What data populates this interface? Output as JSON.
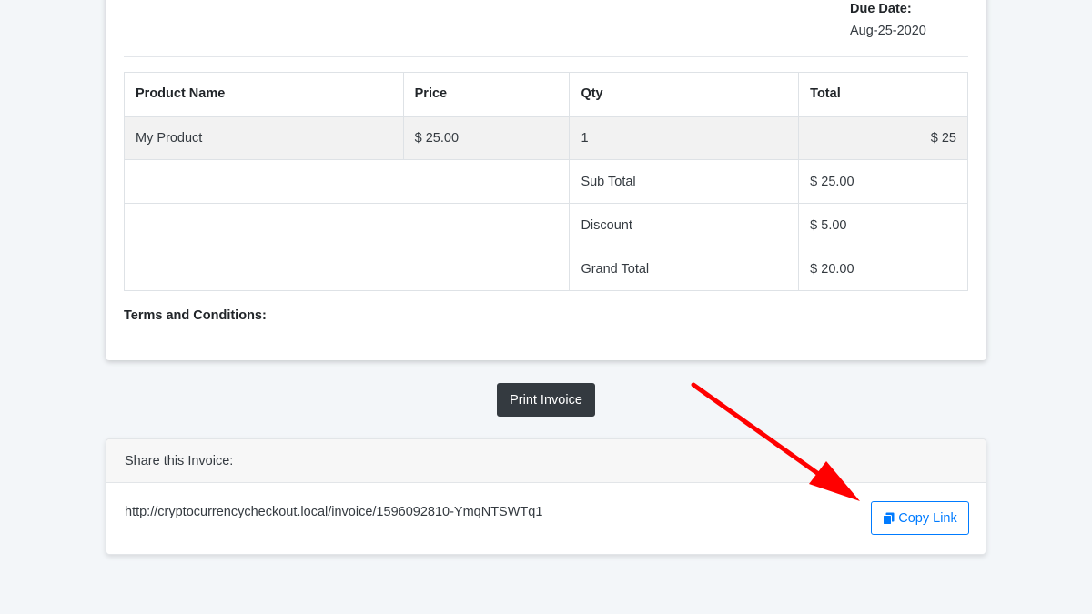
{
  "invoice": {
    "due_label": "Due Date:",
    "due_value": "Aug-25-2020",
    "table": {
      "headers": [
        "Product Name",
        "Price",
        "Qty",
        "Total"
      ],
      "product": {
        "name": "My Product",
        "price": "$ 25.00",
        "qty": "1",
        "total": "$ 25"
      },
      "summary": [
        {
          "label": "Sub Total",
          "value": "$ 25.00"
        },
        {
          "label": "Discount",
          "value": "$ 5.00"
        },
        {
          "label": "Grand Total",
          "value": "$ 20.00"
        }
      ]
    },
    "terms_label": "Terms and Conditions:"
  },
  "actions": {
    "print_label": "Print Invoice"
  },
  "share": {
    "header": "Share this Invoice:",
    "url": "http://cryptocurrencycheckout.local/invoice/1596092810-YmqNTSWTq1",
    "copy_label": "Copy Link",
    "copy_icon": "copy-icon"
  },
  "colors": {
    "page_bg": "#f3f6f9",
    "primary": "#007bff",
    "dark_button": "#343a40",
    "annotation_arrow": "#ff0000"
  }
}
